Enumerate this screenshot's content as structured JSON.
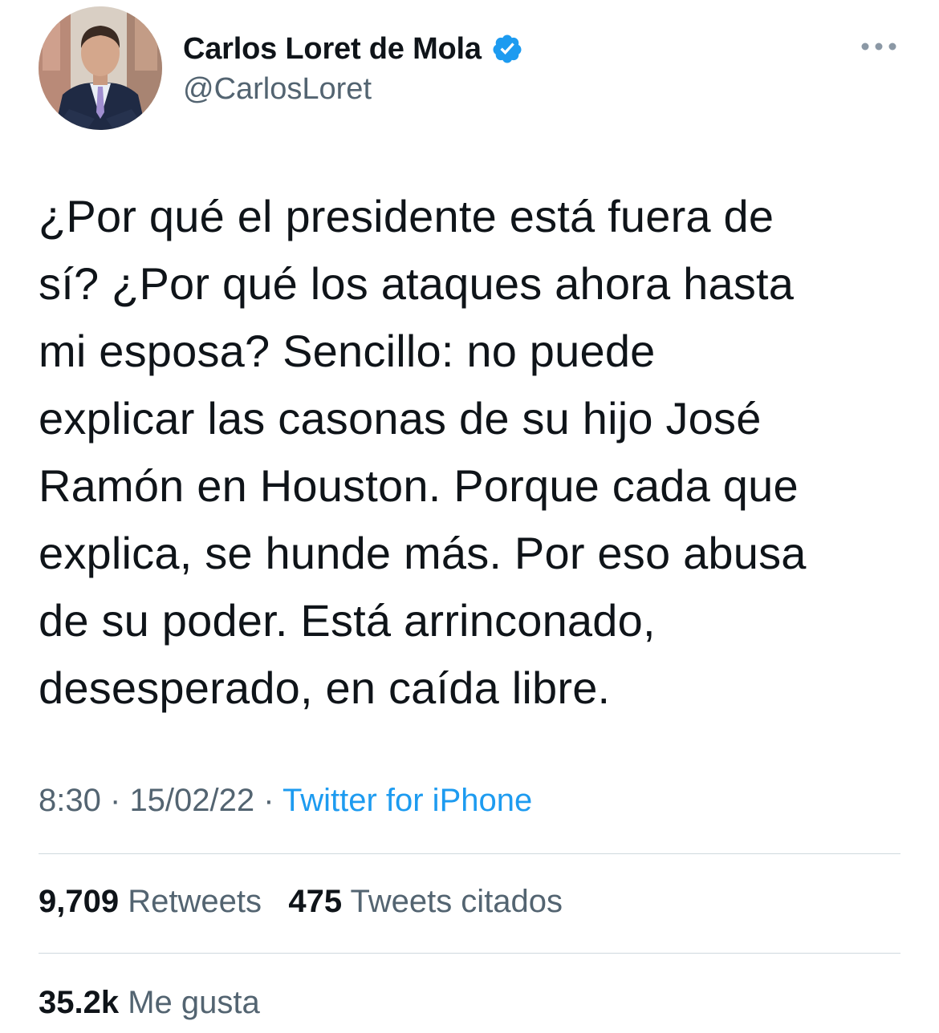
{
  "author": {
    "display_name": "Carlos Loret de Mola",
    "handle": "@CarlosLoret",
    "verified": true,
    "verified_color": "#1d9bf0"
  },
  "tweet": {
    "lines": [
      "¿Por qué el presidente está fuera de",
      "sí? ¿Por qué los ataques ahora hasta",
      "mi esposa? Sencillo: no puede",
      "explicar las casonas de su hijo José",
      "Ramón en Houston. Porque cada que",
      "explica, se hunde más. Por eso abusa",
      "de su poder. Está arrinconado,",
      "desesperado, en caída libre."
    ]
  },
  "meta": {
    "time": "8:30",
    "separator": "·",
    "date": "15/02/22",
    "source": "Twitter for iPhone"
  },
  "stats": {
    "retweets_count": "9,709",
    "retweets_label": "Retweets",
    "quotes_count": "475",
    "quotes_label": "Tweets citados",
    "likes_count": "35.2k",
    "likes_label": "Me gusta"
  },
  "icons": {
    "more": "more-horizontal-icon",
    "verified": "verified-badge-icon"
  }
}
